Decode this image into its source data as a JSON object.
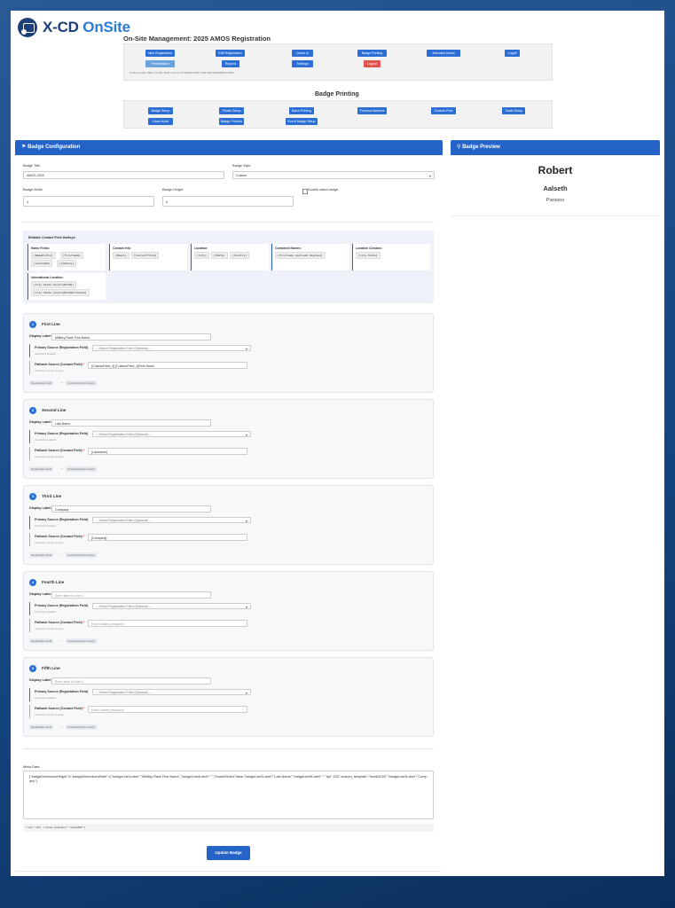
{
  "brand": {
    "name_main": "X-CD",
    "name_accent": "OnSite"
  },
  "page_title": "On-Site Management: 2025 AMOS Registration",
  "nav": {
    "row1": [
      "New Registration",
      "Edit Registration",
      "Check In",
      "Badge Printing",
      "Attendee Admin",
      "Logoff"
    ],
    "row2": [
      "Presentation",
      "Reports",
      "Settings",
      "Logout"
    ],
    "footer": "ConferenceID: 808 | ConfID: 5930 | Source:877E9990-3B17-4B47-8974B7E6B4CC5555"
  },
  "badge_printing": {
    "title": "Badge Printing",
    "row1": [
      "Badge Setup",
      "Printer Setup",
      "Batch Printing",
      "Previous Batches",
      "Custom Print",
      "Ticket Setup"
    ],
    "row2": [
      "Kiosk Mode",
      "Badge Preview",
      "Event Badge Setup"
    ]
  },
  "config": {
    "heading": "Badge Configuration",
    "badge_title_label": "Badge Title",
    "badge_title_value": "AMOS 2025",
    "badge_style_label": "Badge Style",
    "badge_style_value": "Custom",
    "badge_width_label": "Badge Width",
    "badge_width_value": "4",
    "badge_height_label": "Badge Height",
    "badge_height_value": "6",
    "double_sided_label": "Double-sided badge"
  },
  "preview": {
    "heading": "Badge Preview",
    "line1": "Robert",
    "line2": "Aalseth",
    "line3": "Parsons"
  },
  "hotkeys": {
    "title": "Editable Contact Field Hotkeys",
    "groups": [
      {
        "name": "Name Fields:",
        "tags": [
          "[NamePrefix]",
          "[Firstname]",
          "[Lastname]",
          "[Company]"
        ]
      },
      {
        "name": "Contact Info:",
        "tags": [
          "[Email]",
          "[ContactTitle]"
        ]
      },
      {
        "name": "Location:",
        "tags": [
          "[City]",
          "[State]",
          "[Country]"
        ]
      },
      {
        "name": "Combined Names:",
        "tags": [
          "[Firstname Lastname Degrees]"
        ]
      },
      {
        "name": "Location Combos:",
        "tags": [
          "[City State]"
        ]
      },
      {
        "name": "International Location:",
        "tags": [
          "[City State CountryNotUS]",
          "[City State CountryNotUSOrCanada]"
        ]
      }
    ]
  },
  "line_texts": {
    "display_label": "Display Label",
    "primary_label": "Primary Source (Registration Field)",
    "primary_placeholder": "-- Select Registration Field (Optional) --",
    "primary_hint": "Used first if available",
    "fallback_label": "Fallback Source (Contact Field)",
    "fallback_hint": "Used when primary is empty",
    "chip_reg": "Registration Field",
    "arrow": "→",
    "chip_contact": "Contact Field (if empty)",
    "asterisk": "*"
  },
  "lines": [
    {
      "num": "1",
      "title": "First Line",
      "display": "Military Rank First Name",
      "display_placeholder": "Enter label for line 1",
      "fallback": "[CustomField_4] [CustomField_1]First Name",
      "fallback_placeholder": "Enter hotkey (required)"
    },
    {
      "num": "2",
      "title": "Second Line",
      "display": "Last Name",
      "display_placeholder": "Enter label for line 2",
      "fallback": "[Lastname]",
      "fallback_placeholder": "Enter hotkey (required)"
    },
    {
      "num": "3",
      "title": "Third Line",
      "display": "Company",
      "display_placeholder": "Enter label for line 3",
      "fallback": "[Company]",
      "fallback_placeholder": "Enter hotkey (required)"
    },
    {
      "num": "4",
      "title": "Fourth Line",
      "display": "",
      "display_placeholder": "Enter label for line 4",
      "fallback": "",
      "fallback_placeholder": "Enter hotkey (required)"
    },
    {
      "num": "5",
      "title": "Fifth Line",
      "display": "",
      "display_placeholder": "Enter label for line 5",
      "fallback": "",
      "fallback_placeholder": "Enter hotkey (required)"
    }
  ],
  "meta": {
    "label": "Meta Data",
    "value": "{\"badgeDimensionHeight\":6,\"badgeDimensionWidth\":4,\"badgeLine1Label\":\"Military Rank First Name\",\"badgeLine4Label\":\"\",\"DoubleSided\":false,\"badgeLine2Label\":\"Last Name\",\"badgeLine5Label\":\"\",\"dpi\":203,\"custom_template\":\"meds2025\",\"badgeLine3Label\":\"Company\"}",
    "footer": "{\"dpi\":203,\"custom_template\":\"meds2025\"}"
  },
  "update_button": "Update Badge"
}
